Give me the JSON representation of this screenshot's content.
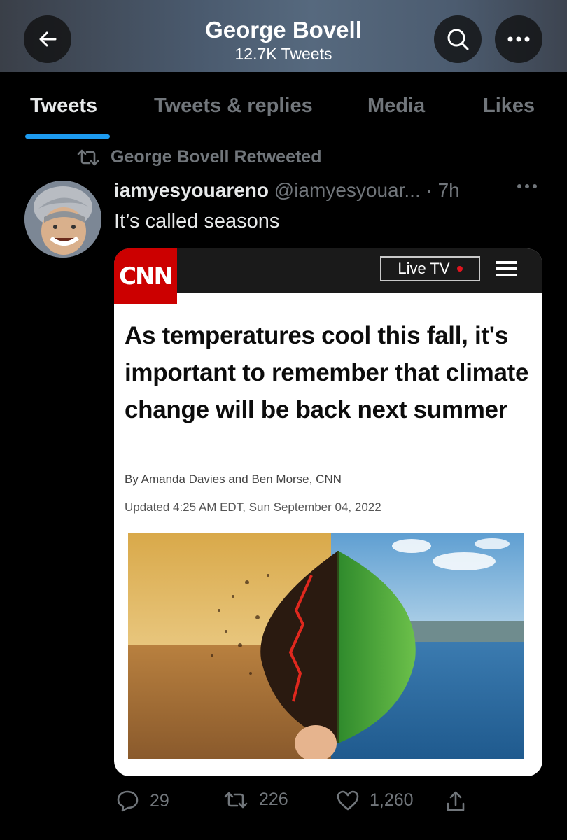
{
  "header": {
    "title": "George Bovell",
    "subtitle": "12.7K Tweets",
    "icons": [
      "back-arrow-icon",
      "search-icon",
      "more-icon"
    ]
  },
  "tabs": [
    {
      "label": "Tweets",
      "active": true
    },
    {
      "label": "Tweets & replies",
      "active": false
    },
    {
      "label": "Media",
      "active": false
    },
    {
      "label": "Likes",
      "active": false
    }
  ],
  "tweet": {
    "retweet_label": "George Bovell Retweeted",
    "display_name": "iamyesyouareno",
    "handle_time": "@iamyesyouar... · 7h",
    "text": "It’s called seasons",
    "media": {
      "logo": "CNN",
      "live_tv": "Live TV",
      "headline": "As temperatures cool this fall, it's important to remember that climate change will be back next summer",
      "byline": "By Amanda Davies and Ben Morse, CNN",
      "updated": "Updated 4:25 AM EDT, Sun September 04, 2022"
    },
    "actions": {
      "replies": "29",
      "retweets": "226",
      "likes": "1,260"
    }
  },
  "colors": {
    "accent": "#1d9bf0",
    "background": "#000000",
    "muted": "#71767b",
    "cnn_red": "#cc0000"
  }
}
